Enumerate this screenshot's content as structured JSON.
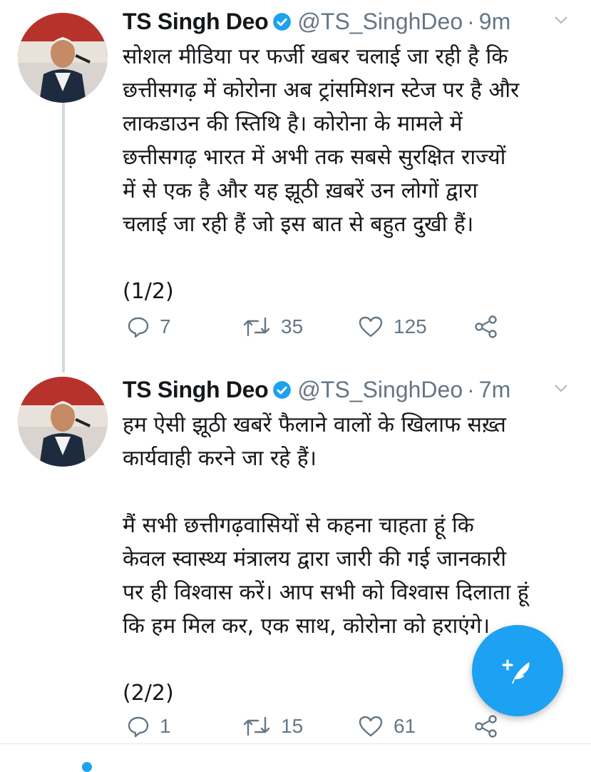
{
  "tweets": [
    {
      "name": "TS Singh Deo",
      "handle": "@TS_SinghDeo",
      "separator": "·",
      "time": "9m",
      "text": "सोशल मीडिया पर फर्जी खबर चलाई जा रही है कि\nछत्तीसगढ़ में कोरोना अब ट्रांसमिशन स्टेज पर है और\nलाकडाउन की स्तिथि है। कोरोना के मामले में\nछत्तीसगढ़ भारत में अभी तक सबसे सुरक्षित राज्यों\nमें से एक है और यह झूठी ख़बरें उन लोगों द्वारा\nचलाई जा रही हैं जो इस बात से बहुत दुखी हैं।\n\n(1/2)",
      "replies": "7",
      "retweets": "35",
      "likes": "125"
    },
    {
      "name": "TS Singh Deo",
      "handle": "@TS_SinghDeo",
      "separator": "·",
      "time": "7m",
      "text": "हम ऐसी झूठी खबरें फैलाने वालों के खिलाफ सख़्त\nकार्यवाही करने जा रहे हैं।\n\nमैं सभी छत्तीगढ़वासियों से कहना चाहता हूं कि\nकेवल स्वास्थ्य मंत्रालय द्वारा जारी की गई जानकारी\nपर ही विश्वास करें। आप सभी को विश्वास दिलाता हूं\nकि हम मिल कर, एक साथ, कोरोना को हराएंगे।\n\n(2/2)",
      "replies": "1",
      "retweets": "15",
      "likes": "61"
    }
  ],
  "colors": {
    "accent": "#1da1f2",
    "secondary_text": "#657786",
    "primary_text": "#14171a",
    "thread_line": "#cfd9de"
  },
  "icons": {
    "verified": "verified-badge-icon",
    "chevron": "chevron-down-icon",
    "reply": "reply-icon",
    "retweet": "retweet-icon",
    "like": "heart-icon",
    "share": "share-icon",
    "compose": "compose-tweet-icon"
  }
}
